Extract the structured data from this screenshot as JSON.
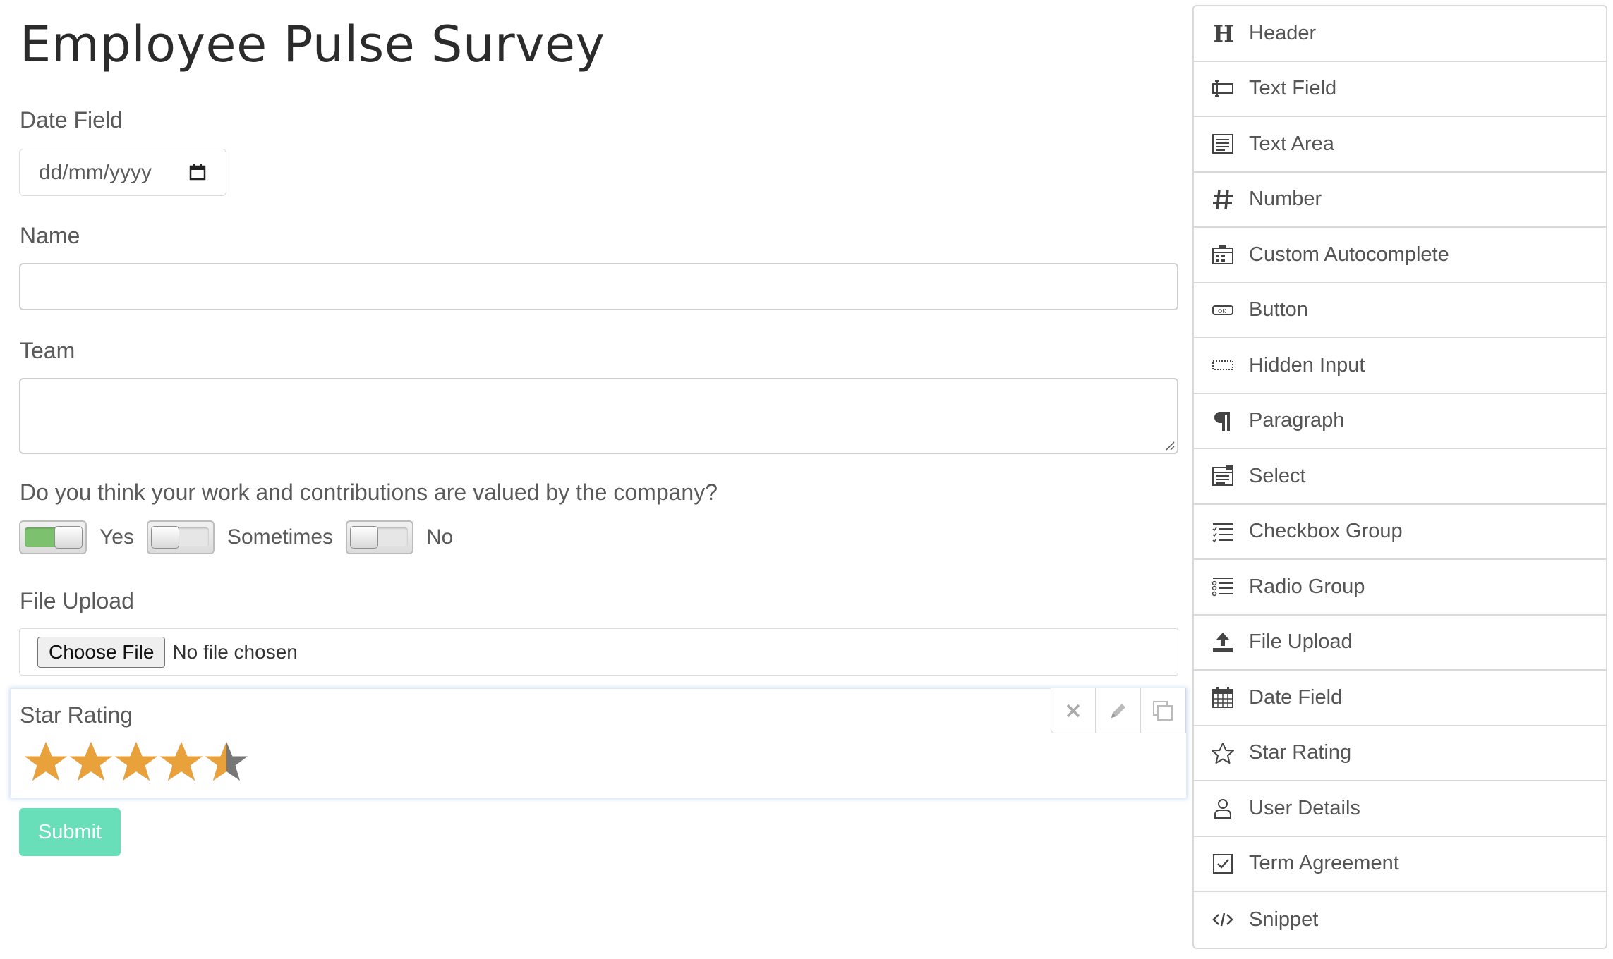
{
  "form": {
    "title": "Employee Pulse Survey",
    "date_field": {
      "label": "Date Field",
      "placeholder": "dd/mm/yyyy"
    },
    "name_field": {
      "label": "Name",
      "value": ""
    },
    "team_field": {
      "label": "Team",
      "value": ""
    },
    "question": {
      "text": "Do you think your work and contributions are valued by the company?",
      "options": [
        {
          "label": "Yes",
          "checked": true
        },
        {
          "label": "Sometimes",
          "checked": false
        },
        {
          "label": "No",
          "checked": false
        }
      ]
    },
    "file_upload": {
      "label": "File Upload",
      "button_label": "Choose File",
      "status": "No file chosen"
    },
    "star_rating": {
      "label": "Star Rating",
      "max": 5,
      "value": 4.5,
      "filled_color": "#e9a23b",
      "empty_color": "#777777"
    },
    "submit_label": "Submit"
  },
  "colors": {
    "accent_submit": "#68dfb8",
    "toggle_on": "#7cc26e",
    "star_filled": "#e9a23b"
  },
  "palette": {
    "items": [
      {
        "label": "Header",
        "icon": "header-icon"
      },
      {
        "label": "Text Field",
        "icon": "text-field-icon"
      },
      {
        "label": "Text Area",
        "icon": "text-area-icon"
      },
      {
        "label": "Number",
        "icon": "hash-icon"
      },
      {
        "label": "Custom Autocomplete",
        "icon": "autocomplete-icon"
      },
      {
        "label": "Button",
        "icon": "button-icon"
      },
      {
        "label": "Hidden Input",
        "icon": "hidden-input-icon"
      },
      {
        "label": "Paragraph",
        "icon": "pilcrow-icon"
      },
      {
        "label": "Select",
        "icon": "select-icon"
      },
      {
        "label": "Checkbox Group",
        "icon": "checkbox-list-icon"
      },
      {
        "label": "Radio Group",
        "icon": "radio-list-icon"
      },
      {
        "label": "File Upload",
        "icon": "upload-icon"
      },
      {
        "label": "Date Field",
        "icon": "calendar-icon"
      },
      {
        "label": "Star Rating",
        "icon": "star-outline-icon"
      },
      {
        "label": "User Details",
        "icon": "user-icon"
      },
      {
        "label": "Term Agreement",
        "icon": "checkbox-checked-icon"
      },
      {
        "label": "Snippet",
        "icon": "code-icon"
      }
    ]
  }
}
